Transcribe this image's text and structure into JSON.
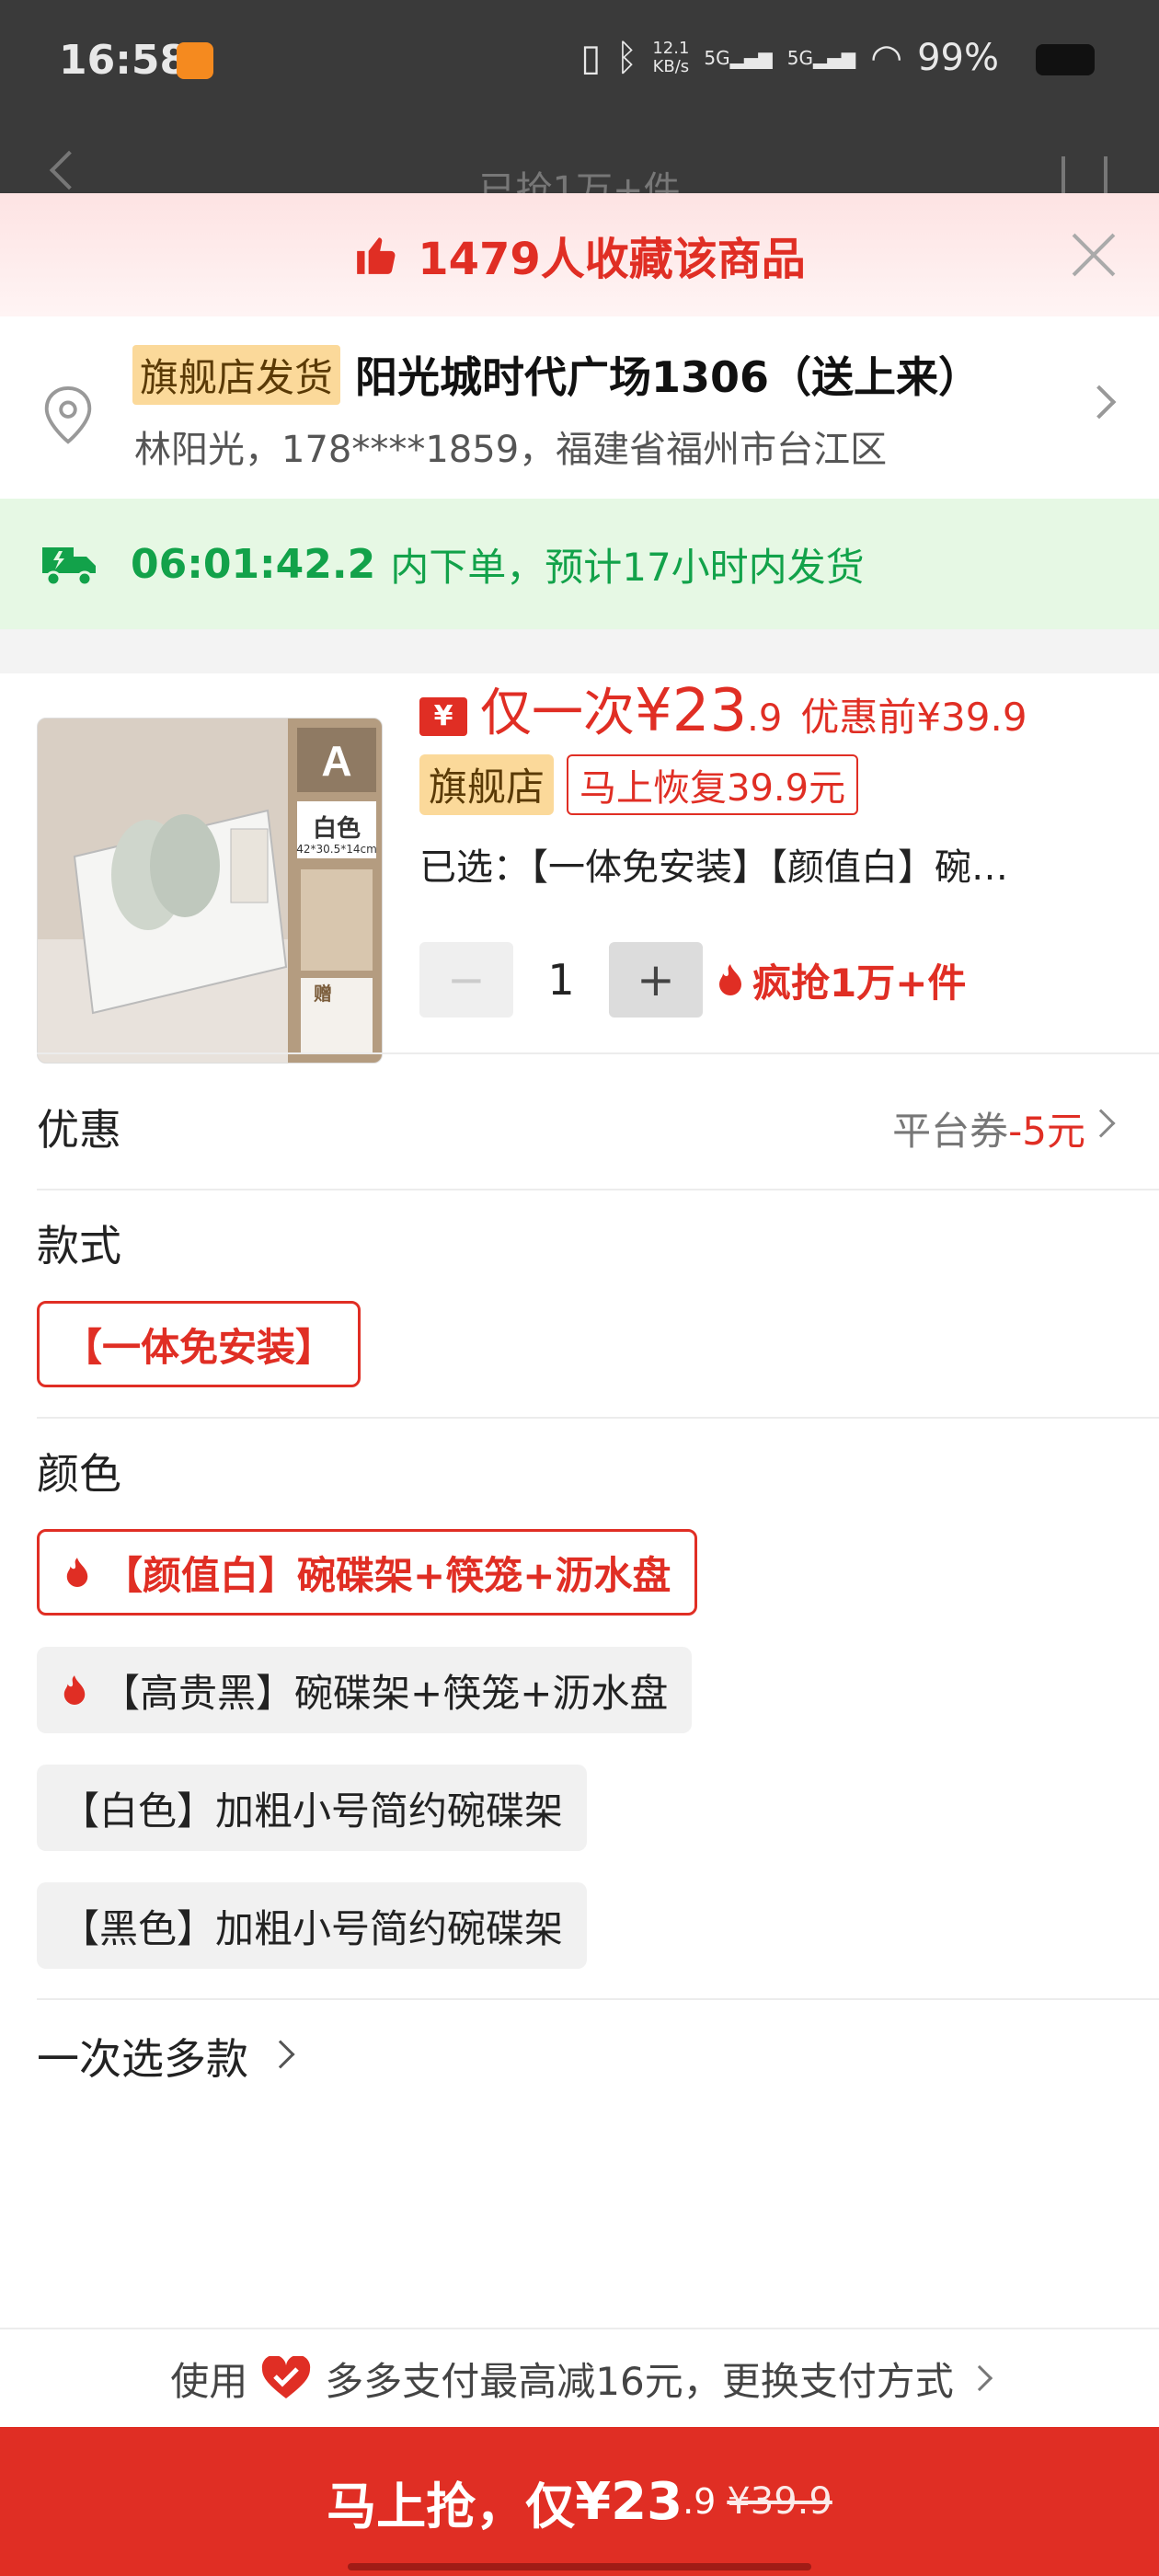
{
  "status_bar": {
    "time": "16:58",
    "speed_top": "12.1",
    "speed_bottom": "KB/s",
    "net1": "5G",
    "net2": "5G",
    "battery": "99%"
  },
  "behind_page": {
    "title": "已抢1万+件"
  },
  "banner": {
    "text": "1479人收藏该商品"
  },
  "address": {
    "tag": "旗舰店发货",
    "main": "阳光城时代广场1306（送上来）",
    "detail": "林阳光，178****1859，福建省福州市台江区"
  },
  "delivery": {
    "countdown": "06:01:42.2",
    "rest": "内下单，预计17小时内发货"
  },
  "product": {
    "coupon_icon": "¥",
    "once_label": "仅一次",
    "price_main": "¥23",
    "price_decimal": ".9",
    "price_before": "优惠前¥39.9",
    "flag_tag": "旗舰店",
    "restore_tag": "马上恢复39.9元",
    "selected": "已选：【一体免安装】【颜值白】碗…",
    "quantity": "1",
    "hot_text": "疯抢1万+件",
    "image": {
      "variant_letter": "A",
      "color": "白色",
      "size": "42*30.5*14cm",
      "gift": "赠"
    }
  },
  "promo": {
    "label": "优惠",
    "right_text": "平台券",
    "amount": "-5元"
  },
  "style": {
    "title": "款式",
    "options": [
      "【一体免安装】"
    ]
  },
  "color": {
    "title": "颜色",
    "options": [
      "【颜值白】碗碟架+筷笼+沥水盘",
      "【高贵黑】碗碟架+筷笼+沥水盘",
      "【白色】加粗小号简约碗碟架",
      "【黑色】加粗小号简约碗碟架"
    ]
  },
  "multi": {
    "label": "一次选多款"
  },
  "pay": {
    "prefix": "使用",
    "text": "多多支付最高减16元，更换支付方式"
  },
  "buy": {
    "label": "马上抢，仅 ",
    "price_main": "¥23",
    "price_decimal": ".9",
    "price_strike": "¥39.9"
  },
  "colors": {
    "accent": "#e02e24",
    "green": "#12a24a",
    "tag_bg": "#fbd99a"
  }
}
